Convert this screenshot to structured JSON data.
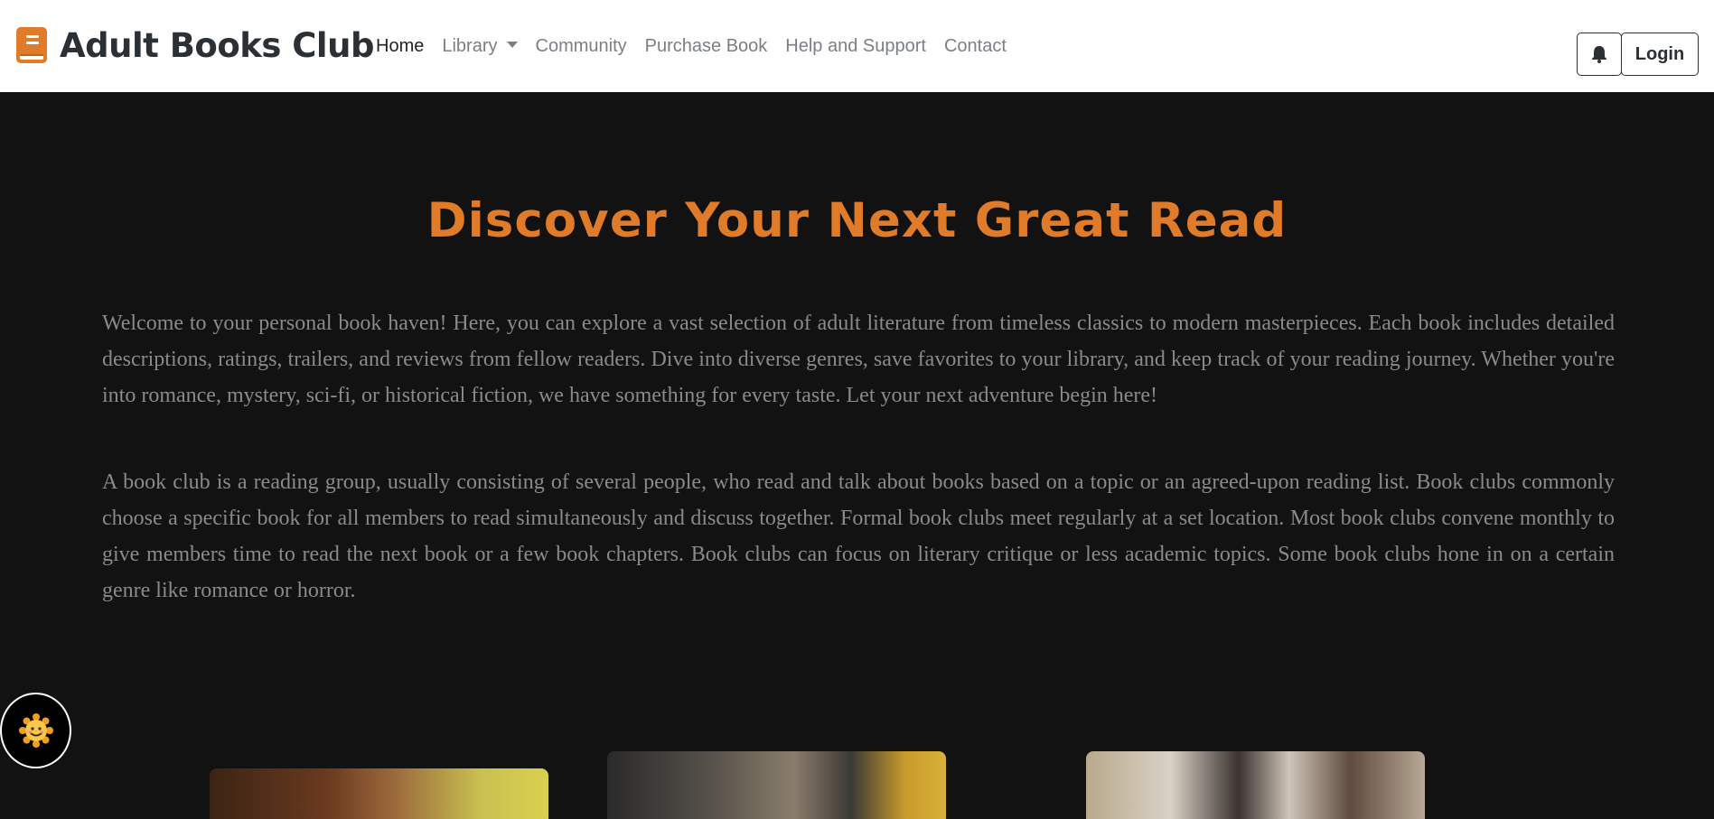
{
  "navbar": {
    "brand": "Adult Books Club",
    "links": [
      {
        "label": "Home",
        "active": true
      },
      {
        "label": "Library",
        "dropdown": true
      },
      {
        "label": "Community"
      },
      {
        "label": "Purchase Book"
      },
      {
        "label": "Help and Support"
      },
      {
        "label": "Contact"
      }
    ],
    "bell_icon": "bell-icon",
    "login_label": "Login"
  },
  "hero": {
    "title": "Discover Your Next Great Read",
    "paragraph1": "Welcome to your personal book haven! Here, you can explore a vast selection of adult literature from timeless classics to modern masterpieces. Each book includes detailed descriptions, ratings, trailers, and reviews from fellow readers. Dive into diverse genres, save favorites to your library, and keep track of your reading journey. Whether you're into romance, mystery, sci-fi, or historical fiction, we have something for every taste. Let your next adventure begin here!",
    "paragraph2": "A book club is a reading group, usually consisting of several people, who read and talk about books based on a topic or an agreed-upon reading list. Book clubs commonly choose a specific book for all members to read simultaneously and discuss together. Formal book clubs meet regularly at a set location. Most book clubs convene monthly to give members time to read the next book or a few book chapters. Book clubs can focus on literary critique or less academic topics. Some book clubs hone in on a certain genre like romance or horror."
  },
  "colors": {
    "accent": "#e07b2a",
    "background": "#121212",
    "text_muted": "#8a8a8a",
    "navbar_bg": "#ffffff"
  },
  "floating_button_icon": "smiling-sun-icon",
  "gallery_icons": [
    "book-club-photo-1",
    "book-club-photo-2",
    "book-club-photo-3"
  ]
}
